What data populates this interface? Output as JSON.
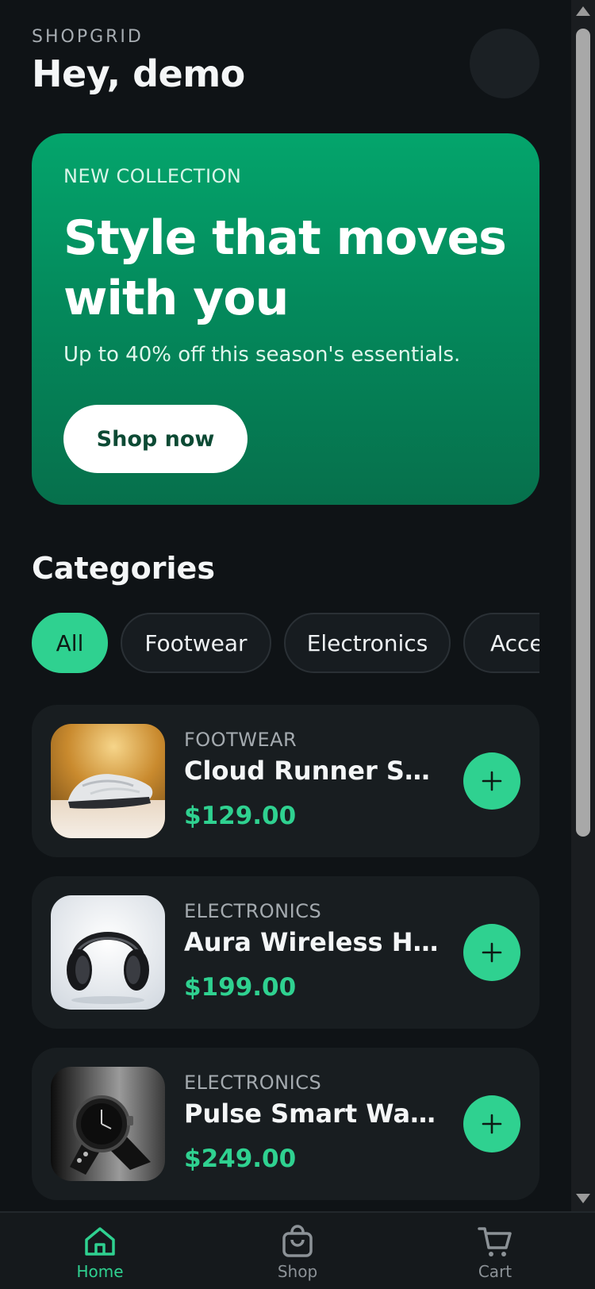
{
  "header": {
    "brand": "SHOPGRID",
    "greeting": "Hey, demo"
  },
  "hero": {
    "eyebrow": "NEW COLLECTION",
    "title": "Style that moves with you",
    "subtitle": "Up to 40% off this season's essentials.",
    "cta": "Shop now"
  },
  "categories": {
    "title": "Categories",
    "chips": [
      "All",
      "Footwear",
      "Electronics",
      "Accessories"
    ],
    "active": "All"
  },
  "products": [
    {
      "category": "FOOTWEAR",
      "name": "Cloud Runner Sneakers",
      "price": "$129.00",
      "image": "sneaker"
    },
    {
      "category": "ELECTRONICS",
      "name": "Aura Wireless Headphones",
      "price": "$199.00",
      "image": "headphones"
    },
    {
      "category": "ELECTRONICS",
      "name": "Pulse Smart Watch",
      "price": "$249.00",
      "image": "watch"
    }
  ],
  "nav": {
    "items": [
      {
        "label": "Home",
        "icon": "home-icon",
        "active": true
      },
      {
        "label": "Shop",
        "icon": "bag-icon",
        "active": false
      },
      {
        "label": "Cart",
        "icon": "cart-icon",
        "active": false
      }
    ]
  },
  "colors": {
    "accent": "#2fd190",
    "background": "#0f1316",
    "card": "#181d20",
    "hero_top": "#04a56c",
    "hero_bottom": "#06704c"
  }
}
